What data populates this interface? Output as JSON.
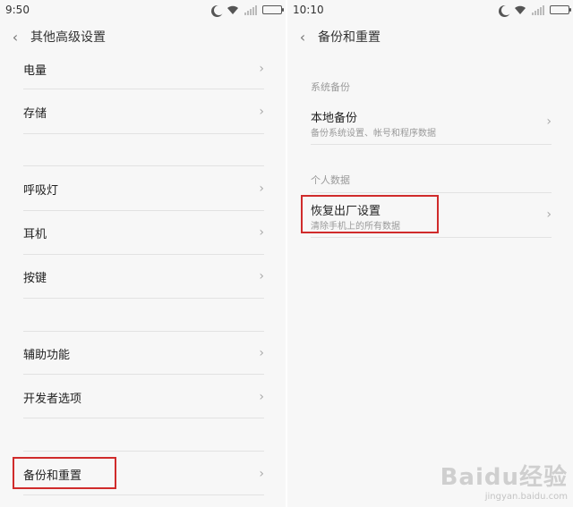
{
  "left": {
    "status": {
      "time": "9:50",
      "battery_level": 1.0
    },
    "header": {
      "title": "其他高级设置"
    },
    "items": [
      {
        "label": "电量"
      },
      {
        "label": "存储"
      },
      {
        "label": "呼吸灯"
      },
      {
        "label": "耳机"
      },
      {
        "label": "按键"
      },
      {
        "label": "辅助功能"
      },
      {
        "label": "开发者选项"
      },
      {
        "label": "备份和重置"
      }
    ]
  },
  "right": {
    "status": {
      "time": "10:10",
      "battery_level": 1.0
    },
    "header": {
      "title": "备份和重置"
    },
    "sections": [
      {
        "label": "系统备份",
        "items": [
          {
            "label": "本地备份",
            "sub": "备份系统设置、帐号和程序数据"
          }
        ]
      },
      {
        "label": "个人数据",
        "items": [
          {
            "label": "恢复出厂设置",
            "sub": "清除手机上的所有数据"
          }
        ]
      }
    ]
  },
  "icons": {
    "back": "chevron-left-icon",
    "chevron": "chevron-right-icon",
    "moon": "moon-icon",
    "wifi": "wifi-icon",
    "signal": "signal-icon",
    "battery": "battery-icon"
  },
  "colors": {
    "highlight": "#d02b2b",
    "background": "#f7f7f7",
    "separator": "#e2e2e2"
  },
  "watermark": {
    "logo": "Baidu经验",
    "url": "jingyan.baidu.com"
  }
}
